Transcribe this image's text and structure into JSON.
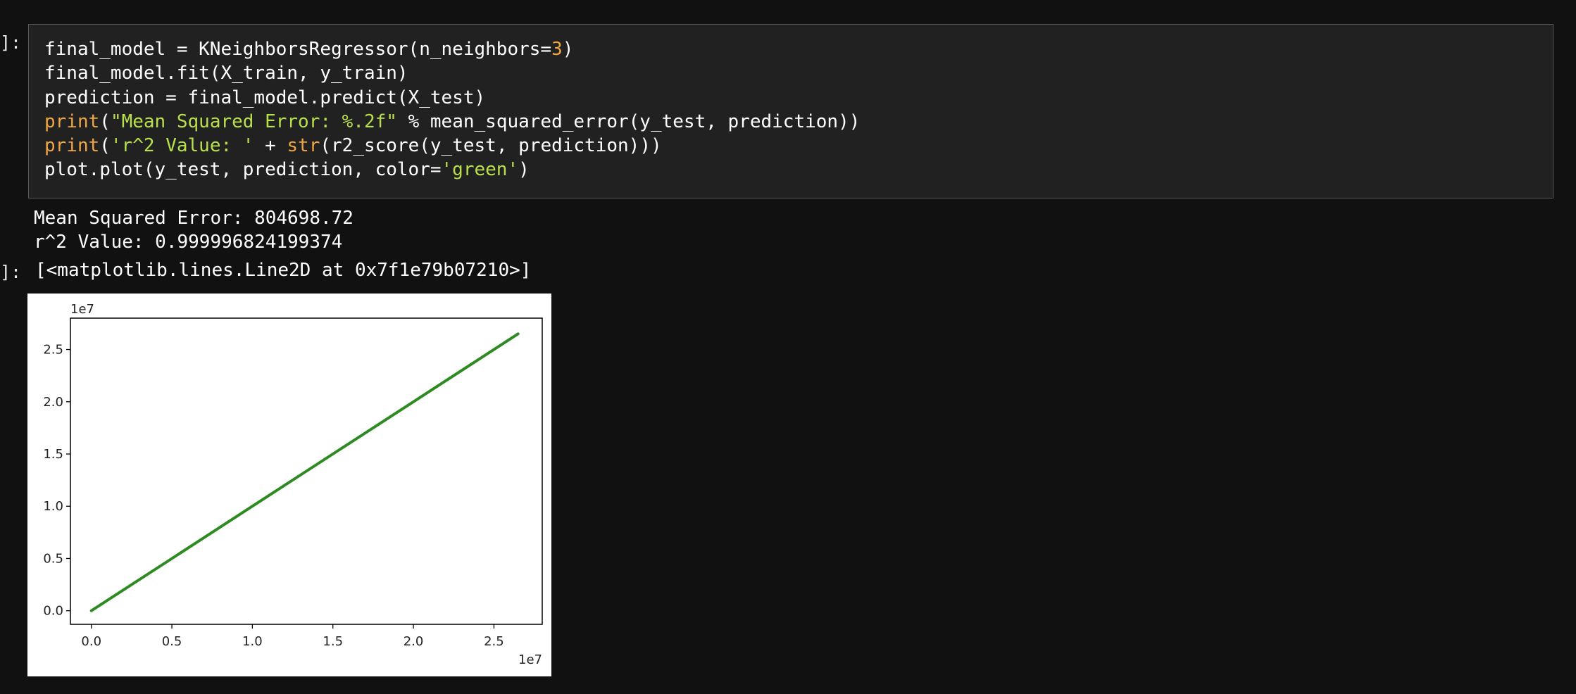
{
  "cell": {
    "input_prompt": "]:",
    "output_prompt": "]:",
    "code": {
      "line1": {
        "a": "final_model = KNeighborsRegressor(n_neighbors=",
        "num": "3",
        "b": ")"
      },
      "line2": "final_model.fit(X_train, y_train)",
      "line3": "prediction = final_model.predict(X_test)",
      "line4": {
        "kw": "print",
        "p1": "(",
        "str": "\"Mean Squared Error: %.2f\"",
        "rest": " % mean_squared_error(y_test, prediction))"
      },
      "line5": {
        "kw": "print",
        "p1": "(",
        "str": "'r^2 Value: '",
        "mid": " + ",
        "kw2": "str",
        "rest": "(r2_score(y_test, prediction)))"
      },
      "line6": {
        "a": "plot.plot(y_test, prediction, color=",
        "str": "'green'",
        "b": ")"
      }
    },
    "stdout": [
      "Mean Squared Error: 804698.72",
      "r^2 Value: 0.999996824199374"
    ],
    "result": "[<matplotlib.lines.Line2D at 0x7f1e79b07210>]"
  },
  "colors": {
    "background": "#111111",
    "cell_bg": "#212121",
    "keyword": "#f0a640",
    "string": "#b7e04a",
    "line": "#2e8b22"
  },
  "chart_data": {
    "type": "line",
    "title": "",
    "xlabel": "",
    "ylabel": "",
    "x_offset_label": "1e7",
    "y_offset_label": "1e7",
    "xlim": [
      -0.13,
      2.8
    ],
    "ylim": [
      -0.13,
      2.8
    ],
    "x_ticks": [
      "0.0",
      "0.5",
      "1.0",
      "1.5",
      "2.0",
      "2.5"
    ],
    "y_ticks": [
      "0.0",
      "0.5",
      "1.0",
      "1.5",
      "2.0",
      "2.5"
    ],
    "grid": false,
    "series": [
      {
        "color": "green",
        "x": [
          0.0,
          0.5,
          1.0,
          1.5,
          2.0,
          2.65
        ],
        "y": [
          0.0,
          0.5,
          1.0,
          1.5,
          2.0,
          2.65
        ]
      }
    ]
  }
}
